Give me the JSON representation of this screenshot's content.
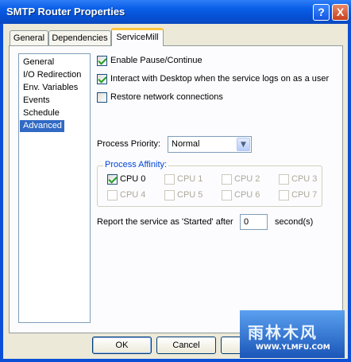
{
  "window": {
    "title": "SMTP Router Properties",
    "help_label": "?",
    "close_label": "X"
  },
  "tabs": [
    {
      "label": "General",
      "active": false
    },
    {
      "label": "Dependencies",
      "active": false
    },
    {
      "label": "ServiceMill",
      "active": true
    }
  ],
  "nav": {
    "items": [
      "General",
      "I/O Redirection",
      "Env. Variables",
      "Events",
      "Schedule",
      "Advanced"
    ],
    "selected": "Advanced"
  },
  "options": {
    "enable_pause": {
      "label": "Enable Pause/Continue",
      "checked": true
    },
    "interact_desktop": {
      "label": "Interact with Desktop when the service logs on as a user",
      "checked": true
    },
    "restore_network": {
      "label": "Restore network connections",
      "checked": false
    }
  },
  "priority": {
    "label": "Process Priority:",
    "value": "Normal"
  },
  "affinity": {
    "label": "Process Affinity:",
    "cpus": [
      {
        "label": "CPU 0",
        "checked": true,
        "enabled": true
      },
      {
        "label": "CPU 1",
        "checked": false,
        "enabled": false
      },
      {
        "label": "CPU 2",
        "checked": false,
        "enabled": false
      },
      {
        "label": "CPU 3",
        "checked": false,
        "enabled": false
      },
      {
        "label": "CPU 4",
        "checked": false,
        "enabled": false
      },
      {
        "label": "CPU 5",
        "checked": false,
        "enabled": false
      },
      {
        "label": "CPU 6",
        "checked": false,
        "enabled": false
      },
      {
        "label": "CPU 7",
        "checked": false,
        "enabled": false
      }
    ]
  },
  "report": {
    "prefix": "Report the service as 'Started' after",
    "value": "0",
    "suffix": "second(s)"
  },
  "buttons": {
    "ok": "OK",
    "cancel": "Cancel"
  },
  "watermark": {
    "brand": "雨林木风",
    "url": "WWW.YLMFU.COM"
  }
}
